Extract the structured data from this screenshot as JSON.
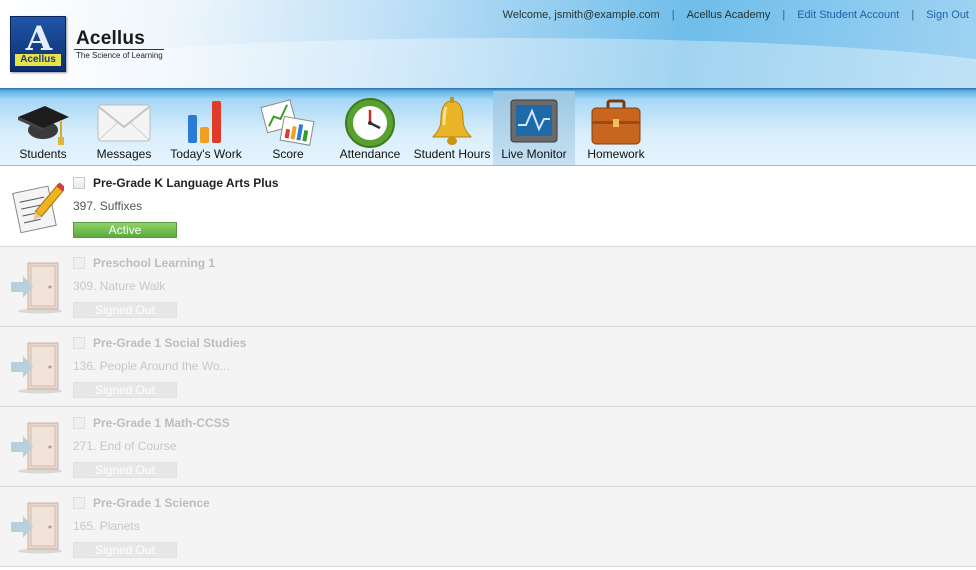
{
  "header": {
    "logo_letter": "A",
    "logo_tag": "Acellus",
    "brand_name": "Acellus",
    "brand_tagline": "The Science of Learning",
    "links": {
      "welcome": "Welcome, jsmith@example.com",
      "academy": "Acellus Academy",
      "edit_account": "Edit Student Account",
      "sign_out": "Sign Out",
      "separator": "|"
    }
  },
  "toolbar": {
    "items": [
      {
        "label": "Students",
        "icon": "graduation-cap-icon"
      },
      {
        "label": "Messages",
        "icon": "envelope-icon"
      },
      {
        "label": "Today's Work",
        "icon": "bar-chart-icon"
      },
      {
        "label": "Score",
        "icon": "charts-icon"
      },
      {
        "label": "Attendance",
        "icon": "clock-icon"
      },
      {
        "label": "Student Hours",
        "icon": "bell-icon"
      },
      {
        "label": "Live Monitor",
        "icon": "monitor-icon"
      },
      {
        "label": "Homework",
        "icon": "briefcase-icon"
      }
    ],
    "active_index": 6
  },
  "courses": [
    {
      "course": "Pre-Grade K Language Arts Plus",
      "lesson": "397. Suffixes",
      "status": "Active",
      "icon": "assignment-pencil-icon"
    },
    {
      "course": "Preschool Learning 1",
      "lesson": "309. Nature Walk",
      "status": "Signed Out",
      "icon": "door-exit-icon"
    },
    {
      "course": "Pre-Grade 1 Social Studies",
      "lesson": "136. People Around the Wo...",
      "status": "Signed Out",
      "icon": "door-exit-icon"
    },
    {
      "course": "Pre-Grade 1 Math-CCSS",
      "lesson": "271. End of Course",
      "status": "Signed Out",
      "icon": "door-exit-icon"
    },
    {
      "course": "Pre-Grade 1 Science",
      "lesson": "165. Planets",
      "status": "Signed Out",
      "icon": "door-exit-icon"
    }
  ],
  "colors": {
    "active_status": "#6cbd48",
    "link": "#1f62a8",
    "toolbar_active": "#a9cde6"
  }
}
